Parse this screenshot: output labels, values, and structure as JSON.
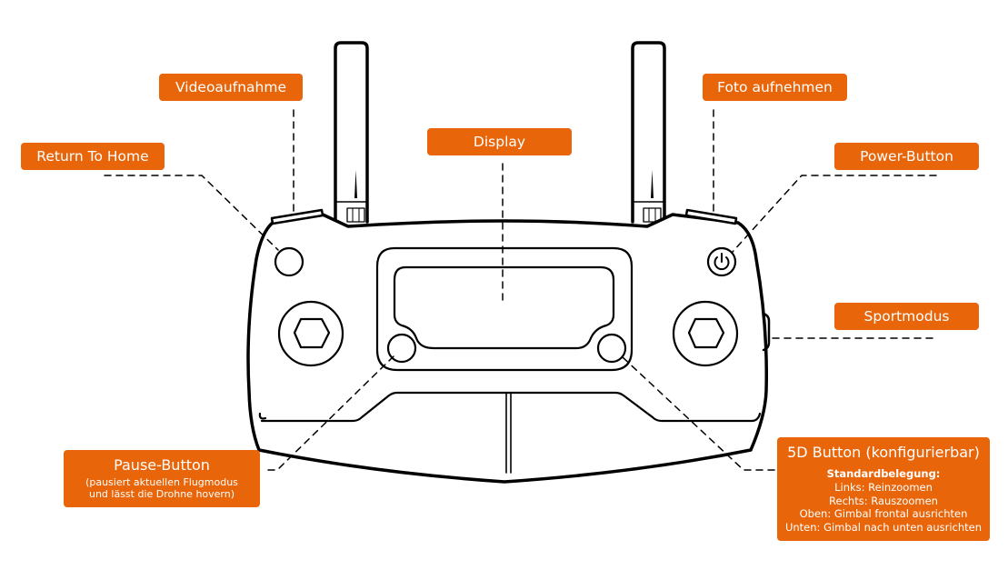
{
  "diagram": {
    "subject": "Drone remote controller (front view)",
    "accent_color": "#e8650a",
    "outline_color": "#000000",
    "background_color": "#ffffff"
  },
  "labels": {
    "video": "Videoaufnahme",
    "rth": "Return To Home",
    "display": "Display",
    "photo": "Foto aufnehmen",
    "power": "Power-Button",
    "sport": "Sportmodus",
    "pause": {
      "title": "Pause-Button",
      "description_lines": [
        "(pausiert aktuellen Flugmodus",
        "und lässt die Drohne hovern)"
      ]
    },
    "five_d": {
      "title": "5D Button (konfigurierbar)",
      "heading": "Standardbelegung:",
      "lines": [
        "Links: Reinzoomen",
        "Rechts: Rauszoomen",
        "Oben: Gimbal frontal ausrichten",
        "Unten: Gimbal nach unten ausrichten"
      ]
    }
  }
}
